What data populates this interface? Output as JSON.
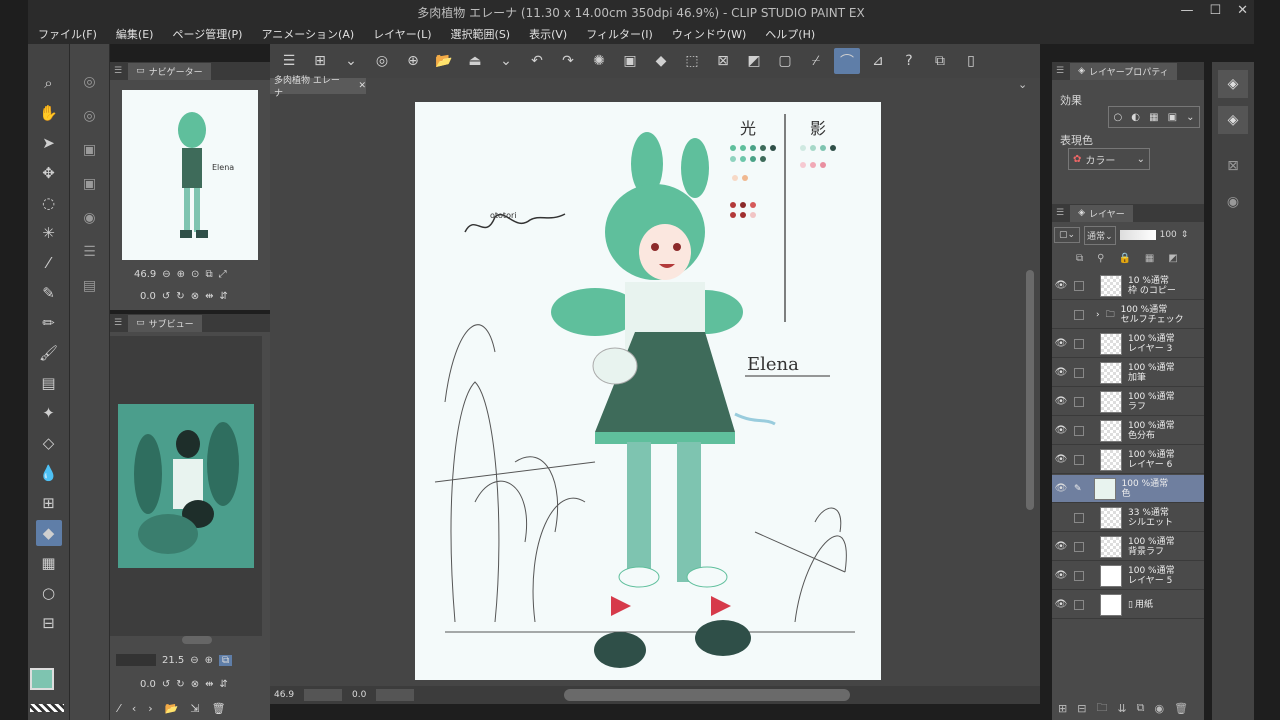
{
  "window": {
    "title": "多肉植物 エレーナ (11.30 x 14.00cm 350dpi 46.9%) - CLIP STUDIO PAINT EX"
  },
  "menu": [
    "ファイル(F)",
    "編集(E)",
    "ページ管理(P)",
    "アニメーション(A)",
    "レイヤー(L)",
    "選択範囲(S)",
    "表示(V)",
    "フィルター(I)",
    "ウィンドウ(W)",
    "ヘルプ(H)"
  ],
  "navigator": {
    "tab": "ナビゲーター",
    "zoom": "46.9",
    "rotation": "0.0"
  },
  "subview": {
    "tab": "サブビュー",
    "zoom": "21.5",
    "rotation": "0.0"
  },
  "document": {
    "tab": "多肉植物 エレーナ",
    "zoom": "46.9",
    "rotation": "0.0"
  },
  "artwork": {
    "light_label": "光",
    "shadow_label": "影",
    "name_sign": "Elena",
    "signature": "ototori"
  },
  "layer_property": {
    "tab": "レイヤープロパティ",
    "effect_label": "効果",
    "color_label": "表現色",
    "color_value": "カラー"
  },
  "layers_panel": {
    "tab": "レイヤー",
    "blend": "通常",
    "opacity": "100",
    "items": [
      {
        "line1": "10 %通常",
        "line2": "枠 のコピー"
      },
      {
        "line1": "100 %通常",
        "line2": "セルフチェック",
        "folder": true
      },
      {
        "line1": "100 %通常",
        "line2": "レイヤー 3"
      },
      {
        "line1": "100 %通常",
        "line2": "加筆"
      },
      {
        "line1": "100 %通常",
        "line2": "ラフ"
      },
      {
        "line1": "100 %通常",
        "line2": "色分布"
      },
      {
        "line1": "100 %通常",
        "line2": "レイヤー 6"
      },
      {
        "line1": "100 %通常",
        "line2": "色",
        "selected": true
      },
      {
        "line1": "33 %通常",
        "line2": "シルエット"
      },
      {
        "line1": "100 %通常",
        "line2": "背景ラフ"
      },
      {
        "line1": "100 %通常",
        "line2": "レイヤー 5"
      },
      {
        "line1": "",
        "line2": "用紙"
      }
    ]
  },
  "colors": {
    "main": "#7ec4b0",
    "accent": "#5f7ea8",
    "char": "#5fbf9c"
  }
}
